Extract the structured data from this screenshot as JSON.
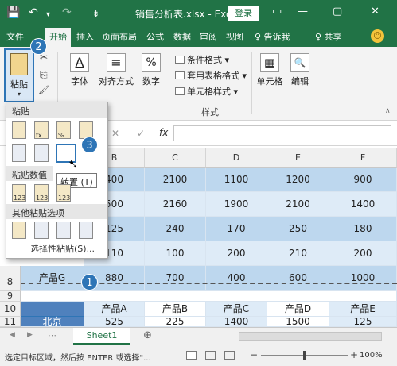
{
  "titlebar": {
    "title": "销售分析表.xlsx - Excel",
    "login": "登录",
    "save_icon": "💾",
    "undo_icon": "↶",
    "redo_icon": "↷",
    "customize_icon": "⇟",
    "ribbon_options_icon": "▭",
    "minimize_icon": "—",
    "restore_icon": "▢",
    "close_icon": "✕"
  },
  "tabs": [
    "文件",
    "开始",
    "插入",
    "页面布局",
    "公式",
    "数据",
    "审阅",
    "视图"
  ],
  "tell_me": "♀ 告诉我",
  "share": "♀ 共享",
  "smiley": "☺",
  "ribbon": {
    "paste_label": "粘贴",
    "font_label": "字体",
    "font_glyph": "A",
    "align_label": "对齐方式",
    "align_glyph": "≡",
    "number_label": "数字",
    "number_glyph": "%",
    "conditional_format": "条件格式 ▾",
    "table_format": "套用表格格式 ▾",
    "cell_styles": "单元格样式 ▾",
    "styles_group": "样式",
    "cells_label": "单元格",
    "cells_glyph": "▦",
    "edit_label": "编辑",
    "edit_glyph": "🔍",
    "cut_glyph": "✂",
    "copy_glyph": "⎘",
    "painter_glyph": "🖌"
  },
  "formula_bar": {
    "cancel": "✕",
    "enter": "✓",
    "fx": "fx"
  },
  "columns": [
    "B",
    "C",
    "D",
    "E",
    "F"
  ],
  "rows": [
    {
      "num": "",
      "cells": [
        "400",
        "2100",
        "1100",
        "1200",
        "900"
      ]
    },
    {
      "num": "",
      "cells": [
        "500",
        "2160",
        "1900",
        "2100",
        "1400"
      ]
    },
    {
      "num": "",
      "cells": [
        "125",
        "240",
        "170",
        "250",
        "180"
      ]
    },
    {
      "num": "",
      "cells": [
        "110",
        "100",
        "200",
        "210",
        "200"
      ]
    },
    {
      "num": "8",
      "label": "产品G",
      "cells": [
        "880",
        "700",
        "400",
        "600",
        "1000"
      ]
    },
    {
      "num": "9",
      "cells": [
        "",
        "",
        "",
        "",
        ""
      ]
    },
    {
      "num": "10",
      "cells": [
        "产品A",
        "产品B",
        "产品C",
        "产品D",
        "产品E"
      ]
    },
    {
      "num": "11",
      "label": "北京",
      "cells": [
        "525",
        "225",
        "1400",
        "1500",
        "125"
      ]
    }
  ],
  "dropdown": {
    "paste_header": "粘贴",
    "values_header": "粘贴数值",
    "other_header": "其他粘贴选项",
    "special": "选择性粘贴(S)...",
    "tooltip": "转置 (T)",
    "tag_123": "123",
    "tag_pct": "%",
    "tag_fx": "fx"
  },
  "steps": [
    "1",
    "2",
    "3"
  ],
  "sheet": {
    "tab": "Sheet1",
    "add": "⊕",
    "prev": "◀",
    "next": "▶",
    "more": "⋯"
  },
  "status": {
    "message": "选定目标区域，然后按 ENTER 或选择\"...",
    "zoom": "100%",
    "minus": "−",
    "plus": "+"
  }
}
